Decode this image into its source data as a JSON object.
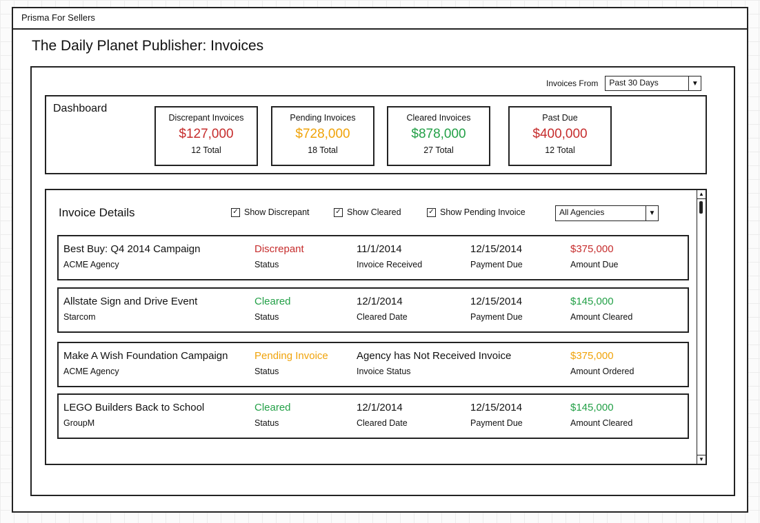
{
  "app": {
    "title": "Prisma For Sellers"
  },
  "page": {
    "title": "The Daily Planet Publisher: Invoices"
  },
  "filter": {
    "label": "Invoices From",
    "value": "Past 30 Days"
  },
  "colors": {
    "red": "#c62d2d",
    "orange": "#f0a30a",
    "green": "#23a047"
  },
  "icons": {
    "dropdown": "triangle-down",
    "checkbox": "check-mark",
    "scroll_up": "triangle-up",
    "scroll_down": "triangle-down"
  },
  "dashboard": {
    "title": "Dashboard",
    "cards": [
      {
        "title": "Discrepant Invoices",
        "amount": "$127,000",
        "total": "12 Total",
        "color": "red"
      },
      {
        "title": "Pending Invoices",
        "amount": "$728,000",
        "total": "18 Total",
        "color": "orange"
      },
      {
        "title": "Cleared Invoices",
        "amount": "$878,000",
        "total": "27 Total",
        "color": "green"
      },
      {
        "title": "Past Due",
        "amount": "$400,000",
        "total": "12 Total",
        "color": "red"
      }
    ]
  },
  "details": {
    "title": "Invoice Details",
    "checkboxes": [
      {
        "label": "Show Discrepant",
        "checked": true
      },
      {
        "label": "Show Cleared",
        "checked": true
      },
      {
        "label": "Show Pending Invoice",
        "checked": true
      }
    ],
    "agencies": {
      "value": "All Agencies"
    },
    "rows": [
      {
        "name": "Best Buy: Q4 2014 Campaign",
        "agency": "ACME Agency",
        "status": "Discrepant",
        "status_label": "Status",
        "status_color": "red",
        "date": "11/1/2014",
        "date_label": "Invoice Received",
        "due": "12/15/2014",
        "due_label": "Payment Due",
        "amount": "$375,000",
        "amount_label": "Amount Due"
      },
      {
        "name": "Allstate Sign and Drive Event",
        "agency": "Starcom",
        "status": "Cleared",
        "status_label": "Status",
        "status_color": "green",
        "date": "12/1/2014",
        "date_label": "Cleared Date",
        "due": "12/15/2014",
        "due_label": "Payment Due",
        "amount": "$145,000",
        "amount_label": "Amount Cleared"
      },
      {
        "name": "Make A Wish Foundation Campaign",
        "agency": "ACME Agency",
        "status": "Pending Invoice",
        "status_label": "Status",
        "status_color": "orange",
        "date": "Agency has Not Received Invoice",
        "date_label": "Invoice Status",
        "due": "",
        "due_label": "",
        "amount": "$375,000",
        "amount_label": "Amount Ordered"
      },
      {
        "name": "LEGO Builders Back to School",
        "agency": "GroupM",
        "status": "Cleared",
        "status_label": "Status",
        "status_color": "green",
        "date": "12/1/2014",
        "date_label": "Cleared Date",
        "due": "12/15/2014",
        "due_label": "Payment Due",
        "amount": "$145,000",
        "amount_label": "Amount Cleared"
      }
    ]
  }
}
